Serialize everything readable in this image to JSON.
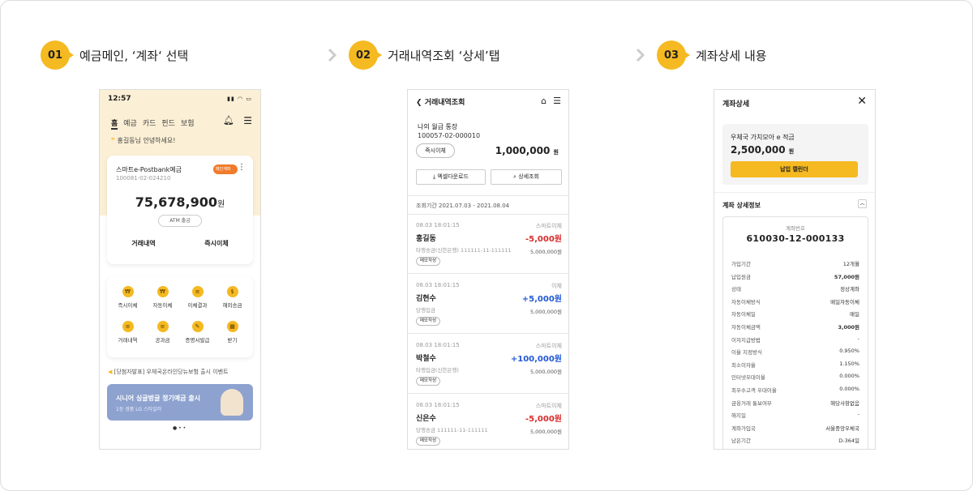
{
  "steps": [
    {
      "num": "01",
      "label": "예금메인, ‘계좌‘ 선택"
    },
    {
      "num": "02",
      "label": "거래내역조회 ‘상세’탭"
    },
    {
      "num": "03",
      "label": "계좌상세 내용"
    }
  ],
  "phone1": {
    "time": "12:57",
    "nav": [
      "홈",
      "예금",
      "카드",
      "펀드",
      "보험"
    ],
    "greeting": "홍길동님 안녕하세요!",
    "card": {
      "title": "스마트e-Postbank예금",
      "number": "100081-02-024210",
      "toggle": "메인계좌",
      "amount": "75,678,900",
      "unit": "원",
      "atm": "ATM 출금",
      "btn1": "거래내역",
      "btn2": "즉시이체"
    },
    "menu": [
      {
        "label": "즉시이체",
        "icon": "₩"
      },
      {
        "label": "자동이체",
        "icon": "₩"
      },
      {
        "label": "이체결과",
        "icon": "≡"
      },
      {
        "label": "해외송금",
        "icon": "$"
      },
      {
        "label": "거래내역",
        "icon": "≡"
      },
      {
        "label": "공과금",
        "icon": "≡"
      },
      {
        "label": "증명서발급",
        "icon": "✎"
      },
      {
        "label": "받기",
        "icon": "▦"
      }
    ],
    "notice": "[당첨자발표] 우체국온라인당뉴보험 출시 이벤트",
    "banner": {
      "title": "시니어 싱글벙글 정기예금 출시",
      "sub": "1등 경품 LG 스타일러"
    },
    "pager": "● • •"
  },
  "phone2": {
    "title": "거래내역조회",
    "account_name": "나의 월급 통장",
    "account_no": "100057-02-000010",
    "immediate": "즉시이체",
    "balance": "1,000,000",
    "balance_unit": "원",
    "excel": "엑셀다운로드",
    "detail": "상세조회",
    "period": "조회기간 2021.07.03 - 2021.08.04",
    "tx": [
      {
        "date": "08.03 18:01:15",
        "type": "스마트이체",
        "name": "홍길동",
        "amount": "-5,000원",
        "sign": "neg",
        "sub": "타행송금(신한은행) 111111-11-111111",
        "rb": "5,000,000원",
        "memo": "메모작성"
      },
      {
        "date": "08.03 18:01:15",
        "type": "이체",
        "name": "김현수",
        "amount": "+5,000원",
        "sign": "pos",
        "sub": "당행입금",
        "rb": "5,000,000원",
        "memo": "메모작성"
      },
      {
        "date": "08.03 18:01:15",
        "type": "스마트이체",
        "name": "박철수",
        "amount": "+100,000원",
        "sign": "pos",
        "sub": "타행입금(신한은행)",
        "rb": "5,000,000원",
        "memo": "메모작성"
      },
      {
        "date": "08.03 18:01:15",
        "type": "스마트이체",
        "name": "신은수",
        "amount": "-5,000원",
        "sign": "neg",
        "sub": "당행송금 111111-11-111111",
        "rb": "5,000,000원",
        "memo": "메모작성"
      }
    ]
  },
  "phone3": {
    "title": "계좌상세",
    "product": "우체국 가치모아 e 적금",
    "amount": "2,500,000",
    "amount_unit": "원",
    "calendar": "납입 캘린더",
    "section": "계좌 상세정보",
    "acct_label": "계좌번호",
    "acct_no": "610030-12-000133",
    "rows": [
      [
        "가입기간",
        "12개월"
      ],
      [
        "납입원금",
        "57,000원"
      ],
      [
        "상태",
        "정상계좌"
      ],
      [
        "자동이체방식",
        "매일자동이체"
      ],
      [
        "자동이체일",
        "매일"
      ],
      [
        "자동이체금액",
        "3,000원"
      ],
      [
        "이자지급방법",
        "-"
      ],
      [
        "이율 지정방식",
        "0.950%"
      ],
      [
        "최소이자율",
        "1.150%"
      ],
      [
        "인터넷우대이율",
        "0.000%"
      ],
      [
        "최우수고객 우대이율",
        "0.000%"
      ],
      [
        "금융거래 통보여부",
        "해당사항없음"
      ],
      [
        "해지일",
        "-"
      ],
      [
        "계좌가입국",
        "서울중앙우체국"
      ],
      [
        "남은기간",
        "D-364일"
      ]
    ]
  }
}
